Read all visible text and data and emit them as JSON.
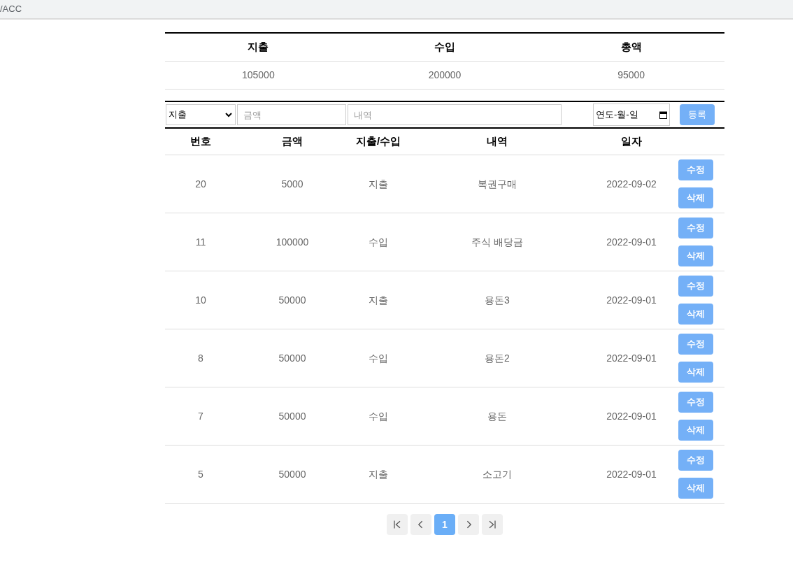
{
  "address_bar": {
    "url": "/ACC"
  },
  "summary": {
    "columns": [
      "지출",
      "수입",
      "총액"
    ],
    "values": [
      "105000",
      "200000",
      "95000"
    ]
  },
  "form": {
    "type_select": {
      "value": "지출"
    },
    "amount": {
      "placeholder": "금액"
    },
    "description": {
      "placeholder": "내역"
    },
    "date": {
      "placeholder": "연도-월-일"
    },
    "submit": "등록"
  },
  "table": {
    "columns": [
      "번호",
      "금액",
      "지출/수입",
      "내역",
      "일자"
    ],
    "rows": [
      {
        "cells": [
          "20",
          "5000",
          "지출",
          "복권구매",
          "2022-09-02"
        ],
        "actions": [
          "수정",
          "삭제"
        ]
      },
      {
        "cells": [
          "11",
          "100000",
          "수입",
          "주식 배당금",
          "2022-09-01"
        ],
        "actions": [
          "수정",
          "삭제"
        ]
      },
      {
        "cells": [
          "10",
          "50000",
          "지출",
          "용돈3",
          "2022-09-01"
        ],
        "actions": [
          "수정",
          "삭제"
        ]
      },
      {
        "cells": [
          "8",
          "50000",
          "수입",
          "용돈2",
          "2022-09-01"
        ],
        "actions": [
          "수정",
          "삭제"
        ]
      },
      {
        "cells": [
          "7",
          "50000",
          "수입",
          "용돈",
          "2022-09-01"
        ],
        "actions": [
          "수정",
          "삭제"
        ]
      },
      {
        "cells": [
          "5",
          "50000",
          "지출",
          "소고기",
          "2022-09-01"
        ],
        "actions": [
          "수정",
          "삭제"
        ]
      }
    ]
  },
  "pagination": {
    "pages": [
      {
        "label": "1",
        "selected": true
      }
    ]
  }
}
